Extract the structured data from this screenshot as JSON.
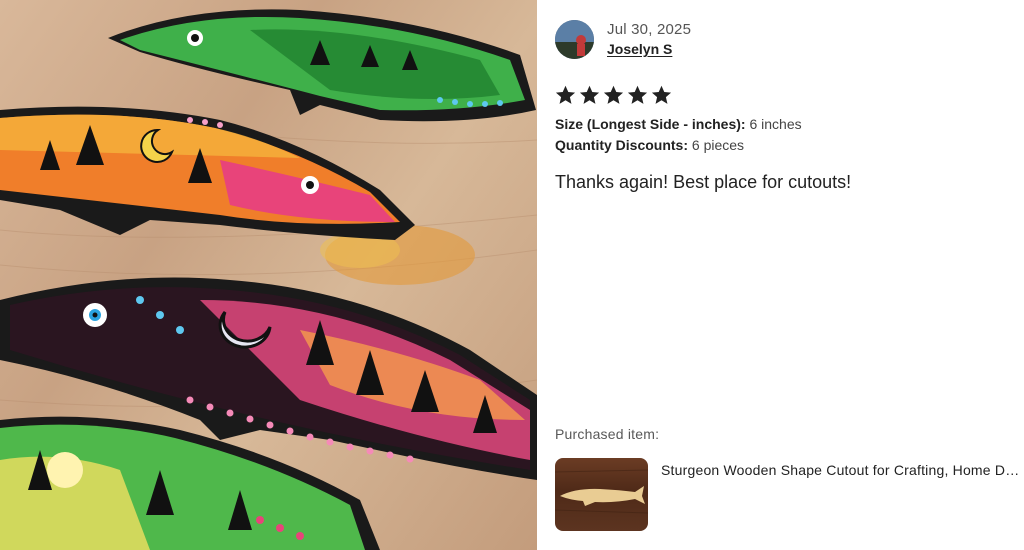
{
  "photo": {
    "icon": "listing-photo-painted-wooden-fish-cutouts"
  },
  "review": {
    "date": "Jul 30, 2025",
    "author": "Joselyn S",
    "rating": 5,
    "attributes": [
      {
        "label": "Size (Longest Side - inches):",
        "value": "6 inches"
      },
      {
        "label": "Quantity Discounts:",
        "value": "6 pieces"
      }
    ],
    "text": "Thanks again! Best place for cutouts!"
  },
  "purchased": {
    "label": "Purchased item:",
    "title": "Sturgeon Wooden Shape Cutout for Crafting, Home Decor, Art Projects & DIY",
    "thumb_icon": "sturgeon-cutout-thumbnail"
  },
  "colors": {
    "star": "#222222",
    "text": "#222222",
    "muted": "#595959"
  }
}
